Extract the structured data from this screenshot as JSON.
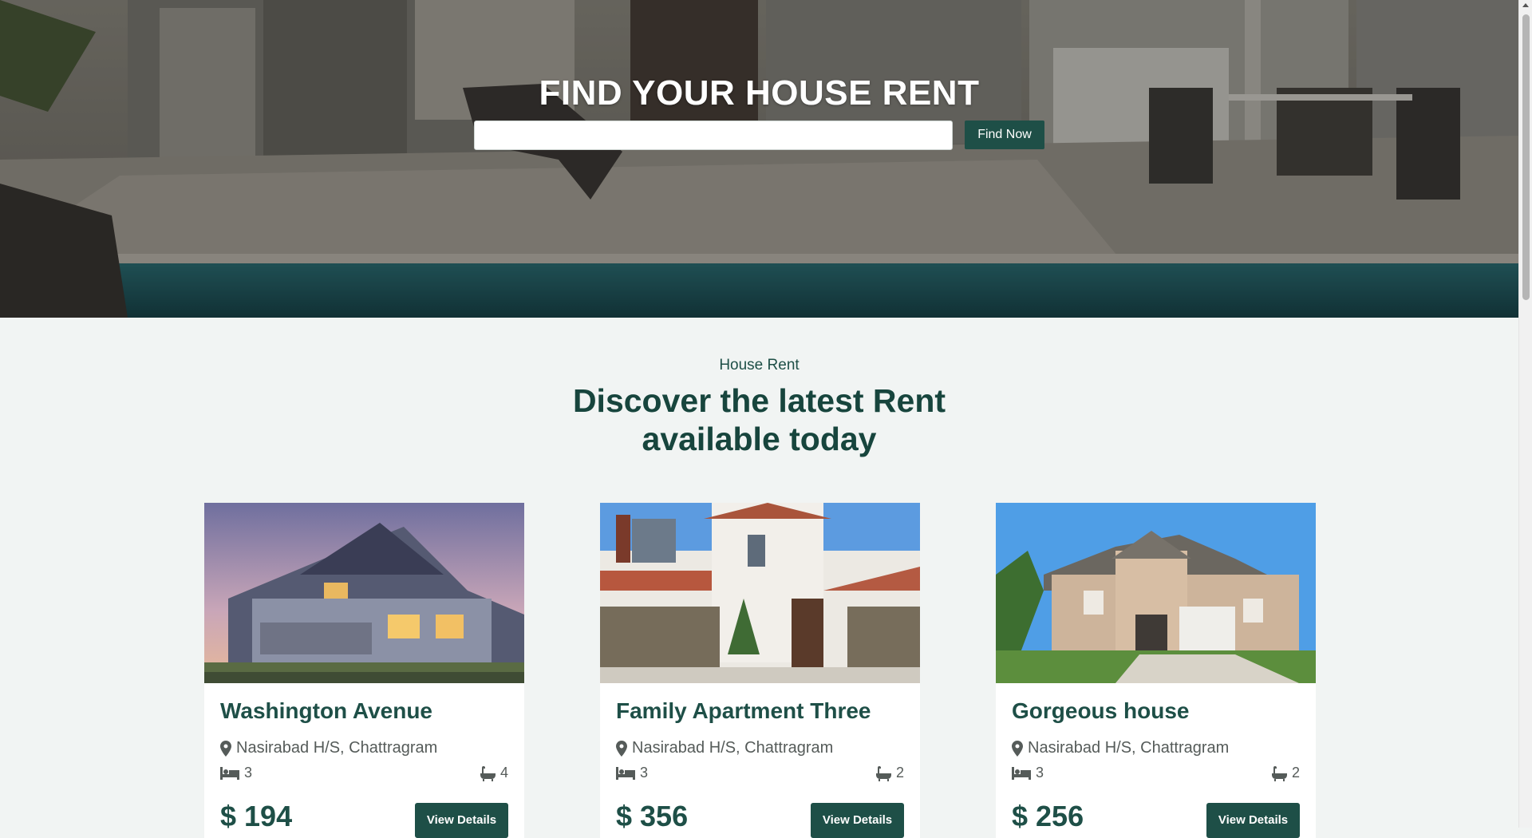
{
  "hero": {
    "title": "FIND YOUR HOUSE RENT",
    "search_placeholder": "",
    "search_value": "",
    "find_label": "Find Now"
  },
  "section": {
    "kicker": "House Rent",
    "title_line1": "Discover the latest Rent",
    "title_line2": "available today"
  },
  "listings": [
    {
      "title": "Washington Avenue",
      "location": "Nasirabad H/S, Chattragram",
      "beds": "3",
      "baths": "4",
      "price": "$ 194",
      "button_label": "View Details"
    },
    {
      "title": "Family Apartment Three",
      "location": "Nasirabad H/S, Chattragram",
      "beds": "3",
      "baths": "2",
      "price": "$ 356",
      "button_label": "View Details"
    },
    {
      "title": "Gorgeous house",
      "location": "Nasirabad H/S, Chattragram",
      "beds": "3",
      "baths": "2",
      "price": "$ 256",
      "button_label": "View Details"
    }
  ],
  "icons": {
    "location": "map-pin-icon",
    "beds": "bed-icon",
    "baths": "bathtub-icon"
  },
  "colors": {
    "brand": "#1e4f47",
    "page_bg": "#f1f4f3"
  }
}
